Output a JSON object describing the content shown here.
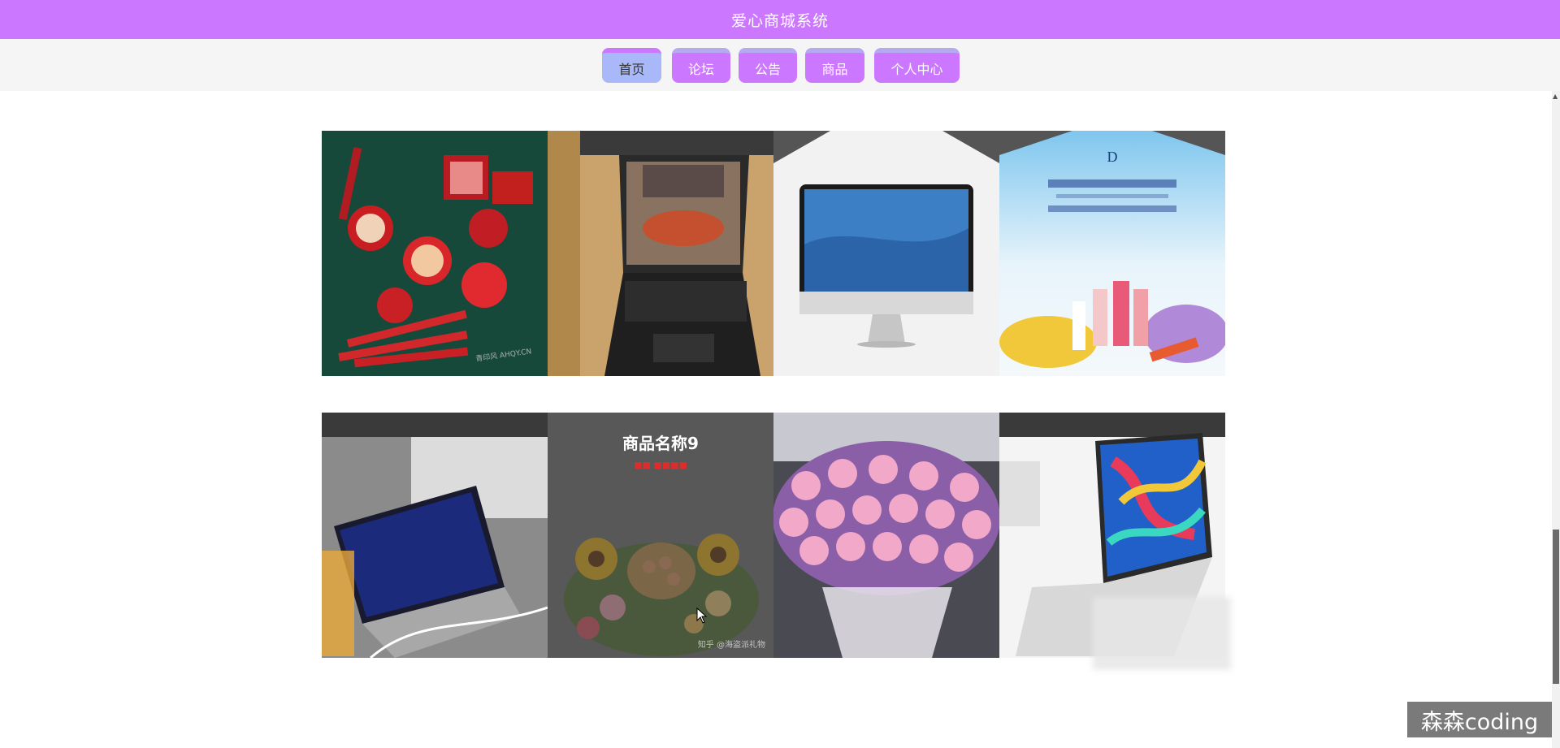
{
  "app": {
    "title": "爱心商城系统"
  },
  "nav": {
    "items": [
      {
        "label": "首页",
        "active": true
      },
      {
        "label": "论坛",
        "active": false
      },
      {
        "label": "公告",
        "active": false
      },
      {
        "label": "商品",
        "active": false
      },
      {
        "label": "个人中心",
        "active": false
      }
    ]
  },
  "products": {
    "hovered": {
      "name": "商品名称9"
    }
  },
  "image_captions": {
    "makeup": "青印风 AHQY.CN",
    "flowers": "知乎 @海盗派礼物"
  },
  "watermark": "森森coding",
  "colors": {
    "header": "#cc77ff",
    "nav_button": "#cc77ff",
    "nav_active": "#a8b8f8",
    "nav_bar_bg": "#f5f5f5"
  },
  "icons": {
    "scroll_up": "triangle-up-icon",
    "cursor": "mouse-pointer-icon"
  }
}
